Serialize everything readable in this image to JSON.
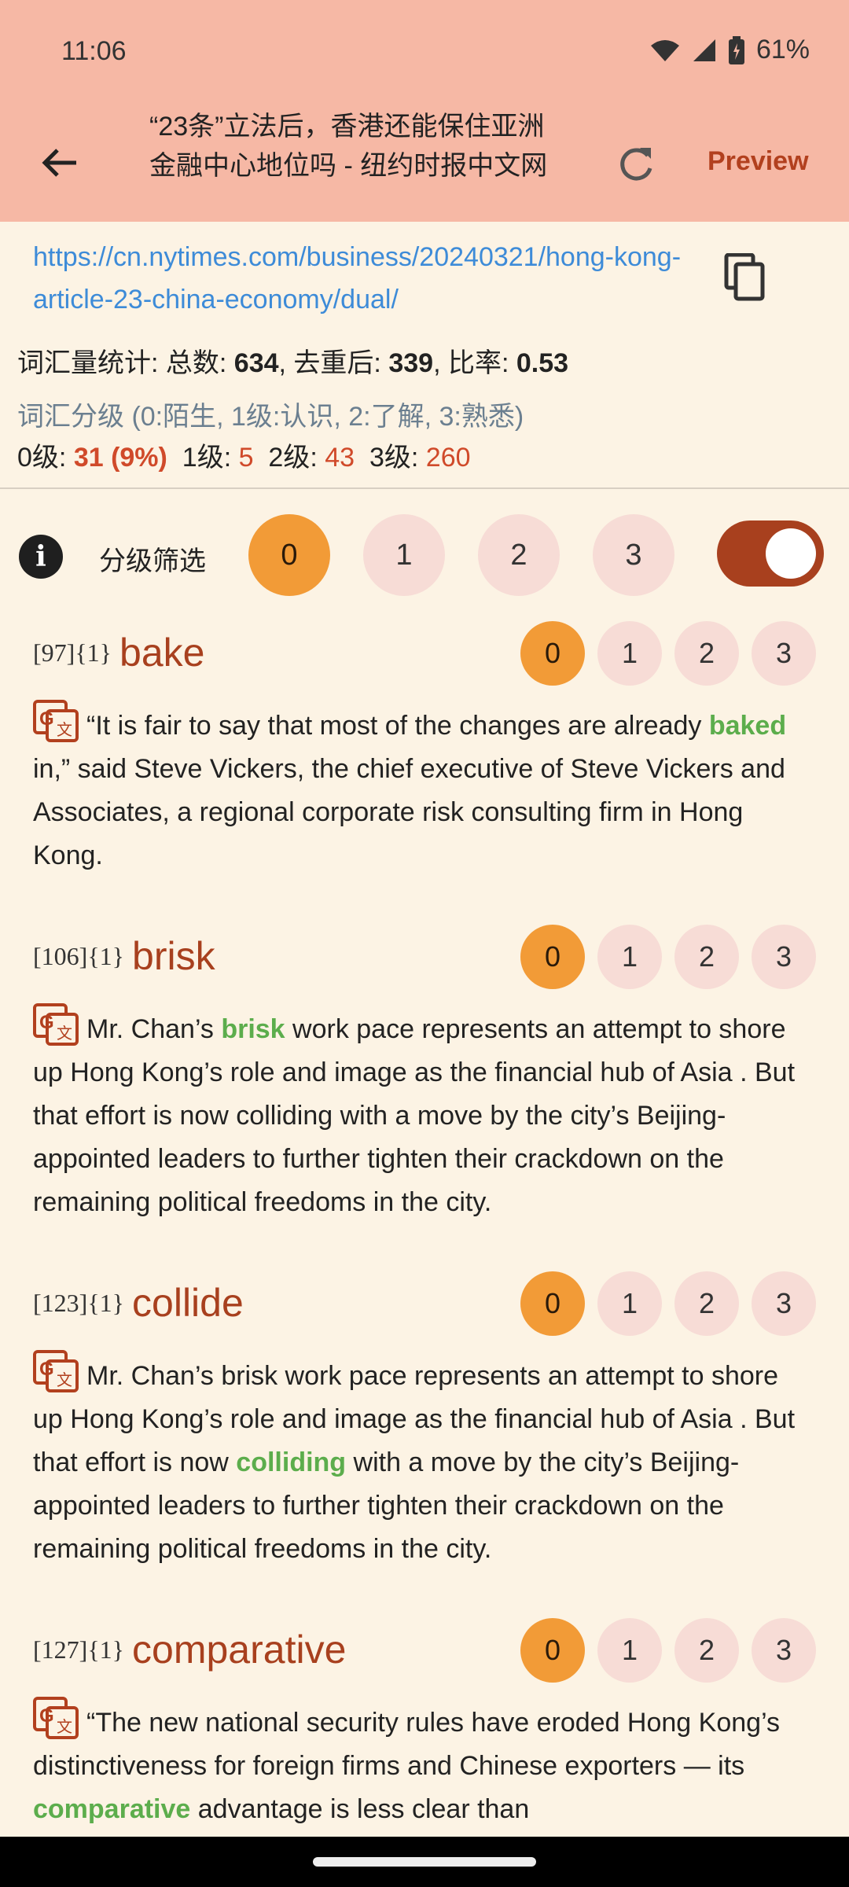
{
  "status": {
    "time": "11:06",
    "battery": "61%"
  },
  "appbar": {
    "title": "“23条”立法后，香港还能保住亚洲金融中心地位吗 - 纽约时报中文网",
    "preview_label": "Preview"
  },
  "url": "https://cn.nytimes.com/business/20240321/hong-kong-article-23-china-economy/dual/",
  "stats": {
    "prefix": "词汇量统计: 总数: ",
    "total": "634",
    "sep1": ", 去重后: ",
    "unique": "339",
    "sep2": ", 比率: ",
    "ratio": "0.53"
  },
  "grade_caption": "词汇分级 (0:陌生, 1级:认识, 2:了解, 3:熟悉)",
  "grade_counts": {
    "l0_label": "0级: ",
    "l0_value": "31 (9%)",
    "l1_label": "1级: ",
    "l1_value": "5",
    "l2_label": "2级: ",
    "l2_value": "43",
    "l3_label": "3级: ",
    "l3_value": "260"
  },
  "filter": {
    "label": "分级筛选",
    "levels": [
      "0",
      "1",
      "2",
      "3"
    ],
    "active": "0"
  },
  "levels": [
    "0",
    "1",
    "2",
    "3"
  ],
  "words": [
    {
      "index": "[97]{1}",
      "word": "bake",
      "before": "“It is fair to say that most of the changes are already ",
      "highlight": "baked",
      "after": " in,” said Steve Vickers, the chief executive of Steve Vickers and Associates, a regional corporate risk consulting firm in Hong Kong."
    },
    {
      "index": "[106]{1}",
      "word": "brisk",
      "before": "Mr. Chan’s ",
      "highlight": "brisk",
      "after": " work pace represents an attempt to shore up Hong Kong’s role and image as the financial hub of Asia . But that effort is now colliding with a move by the city’s Beijing-appointed leaders to further tighten their crackdown on the remaining political freedoms in the city."
    },
    {
      "index": "[123]{1}",
      "word": "collide",
      "before": "Mr. Chan’s brisk work pace represents an attempt to shore up Hong Kong’s role and image as the financial hub of Asia . But that effort is now ",
      "highlight": "colliding",
      "after": " with a move by the city’s Beijing-appointed leaders to further tighten their crackdown on the remaining political freedoms in the city."
    },
    {
      "index": "[127]{1}",
      "word": "comparative",
      "before": "“The new national security rules have eroded Hong Kong’s distinctiveness for foreign firms and Chinese exporters — its ",
      "highlight": "comparative",
      "after": " advantage is less clear than"
    }
  ]
}
